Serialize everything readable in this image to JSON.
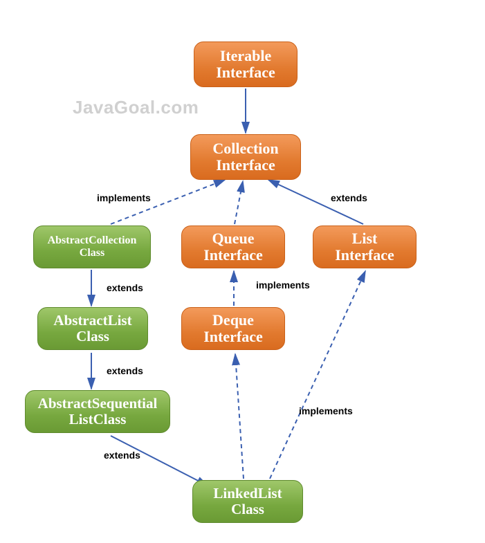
{
  "watermark": "JavaGoal.com",
  "nodes": {
    "iterable": {
      "line1": "Iterable",
      "line2": "Interface"
    },
    "collection": {
      "line1": "Collection",
      "line2": "Interface"
    },
    "absColl": {
      "line1": "AbstractCollection",
      "line2": "Class"
    },
    "queue": {
      "line1": "Queue",
      "line2": "Interface"
    },
    "list": {
      "line1": "List",
      "line2": "Interface"
    },
    "absList": {
      "line1": "AbstractList",
      "line2": "Class"
    },
    "deque": {
      "line1": "Deque",
      "line2": "Interface"
    },
    "absSeq": {
      "line1": "AbstractSequential",
      "line2": "ListClass"
    },
    "linked": {
      "line1": "LinkedList",
      "line2": "Class"
    }
  },
  "labels": {
    "implements1": "implements",
    "extends1": "extends",
    "extends2": "extends",
    "implements2": "implements",
    "extends3": "extends",
    "extends4": "extends",
    "implements3": "implements"
  },
  "colors": {
    "arrowBlue": "#3a5fb0"
  },
  "chart_data": {
    "type": "hierarchy-diagram",
    "nodes": [
      {
        "id": "Iterable Interface",
        "kind": "interface"
      },
      {
        "id": "Collection Interface",
        "kind": "interface"
      },
      {
        "id": "AbstractCollection Class",
        "kind": "class"
      },
      {
        "id": "Queue Interface",
        "kind": "interface"
      },
      {
        "id": "List Interface",
        "kind": "interface"
      },
      {
        "id": "AbstractList Class",
        "kind": "class"
      },
      {
        "id": "Deque Interface",
        "kind": "interface"
      },
      {
        "id": "AbstractSequentialList Class",
        "kind": "class"
      },
      {
        "id": "LinkedList Class",
        "kind": "class"
      }
    ],
    "edges": [
      {
        "from": "Collection Interface",
        "to": "Iterable Interface",
        "relation": "extends"
      },
      {
        "from": "AbstractCollection Class",
        "to": "Collection Interface",
        "relation": "implements"
      },
      {
        "from": "Queue Interface",
        "to": "Collection Interface",
        "relation": "extends"
      },
      {
        "from": "List Interface",
        "to": "Collection Interface",
        "relation": "extends"
      },
      {
        "from": "AbstractList Class",
        "to": "AbstractCollection Class",
        "relation": "extends"
      },
      {
        "from": "Deque Interface",
        "to": "Queue Interface",
        "relation": "implements"
      },
      {
        "from": "AbstractSequentialList Class",
        "to": "AbstractList Class",
        "relation": "extends"
      },
      {
        "from": "LinkedList Class",
        "to": "AbstractSequentialList Class",
        "relation": "extends"
      },
      {
        "from": "LinkedList Class",
        "to": "Deque Interface",
        "relation": "implements"
      },
      {
        "from": "LinkedList Class",
        "to": "List Interface",
        "relation": "implements"
      }
    ]
  }
}
